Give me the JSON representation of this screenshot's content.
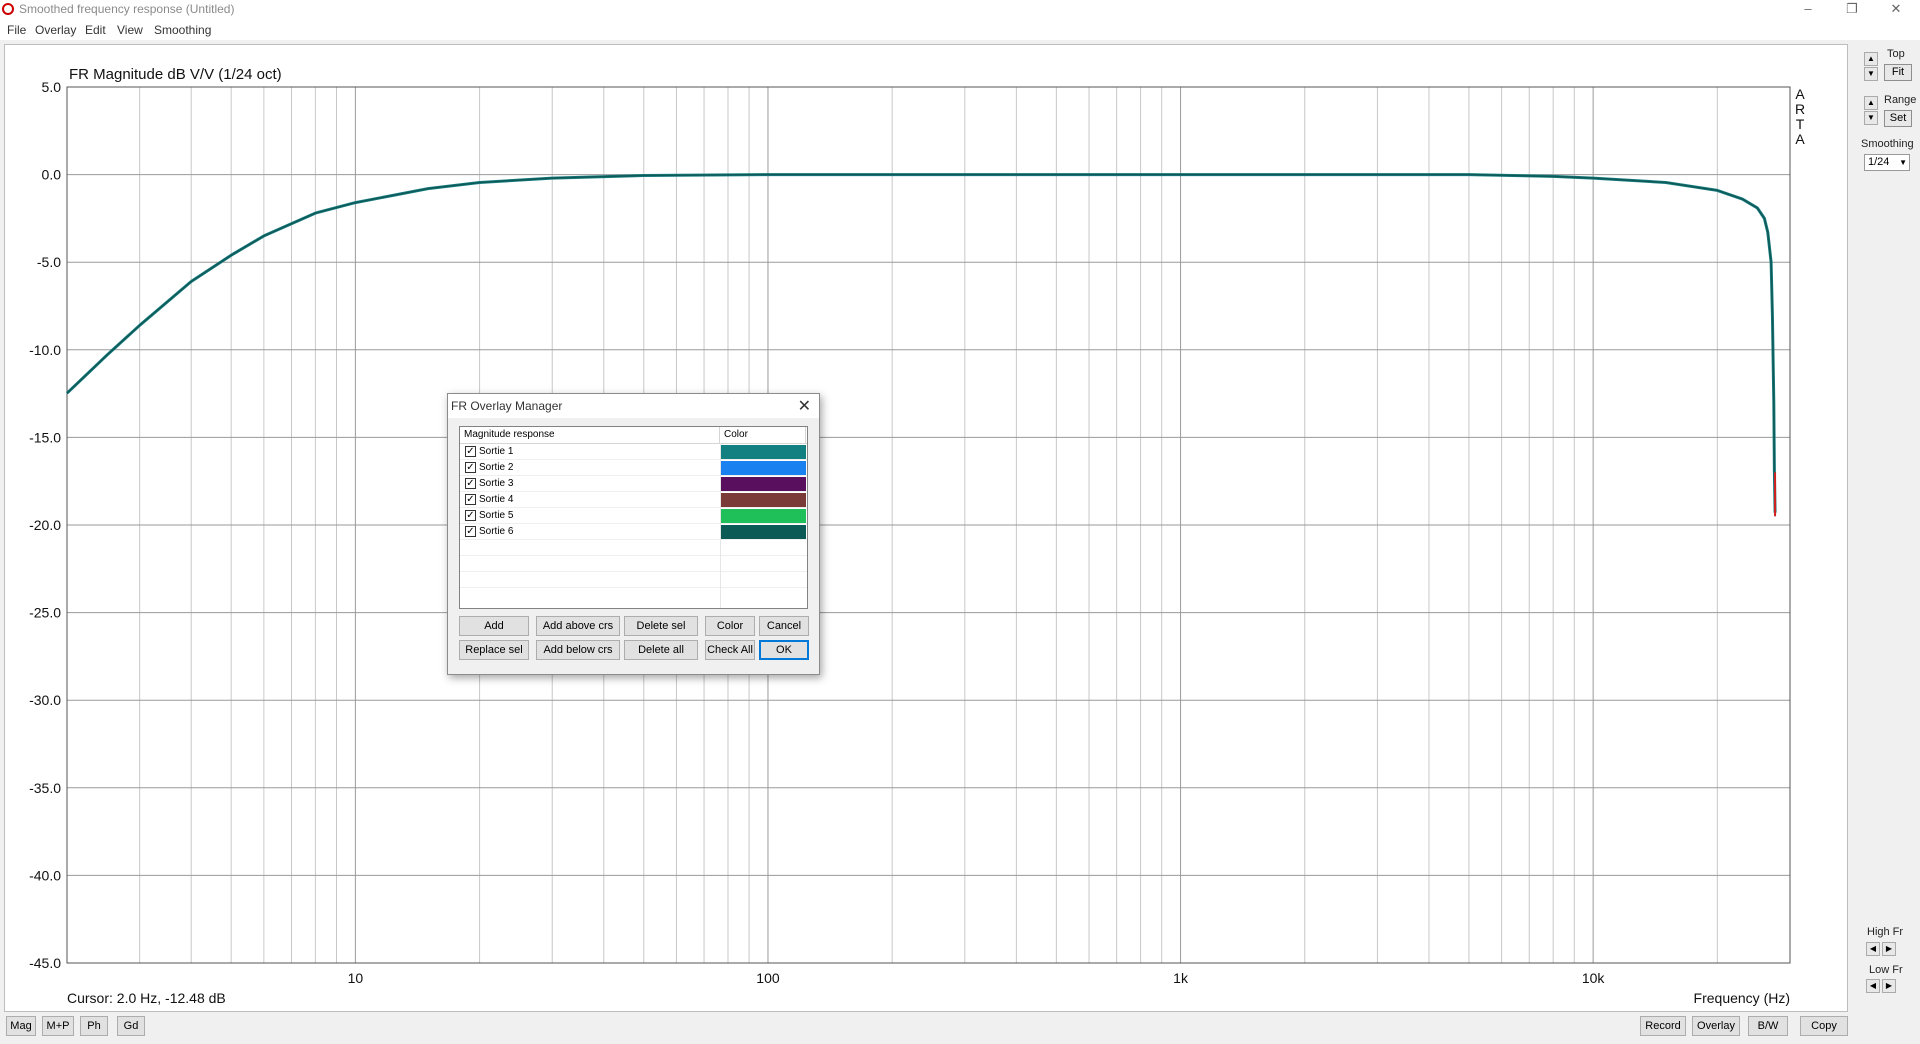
{
  "window": {
    "title": "Smoothed frequency response (Untitled)",
    "minimize": "–",
    "restore": "❐",
    "close": "✕"
  },
  "menu": [
    "File",
    "Overlay",
    "Edit",
    "View",
    "Smoothing"
  ],
  "chart_data": {
    "type": "line",
    "title": "FR Magnitude dB V/V (1/24 oct)",
    "xlabel": "Frequency (Hz)",
    "ylabel": "",
    "x_scale": "log",
    "xlim": [
      2,
      30000
    ],
    "ylim": [
      -45,
      5
    ],
    "y_ticks": [
      "5.0",
      "0.0",
      "-5.0",
      "-10.0",
      "-15.0",
      "-20.0",
      "-25.0",
      "-30.0",
      "-35.0",
      "-40.0",
      "-45.0"
    ],
    "x_tick_labels": [
      {
        "value": 10,
        "label": "10"
      },
      {
        "value": 100,
        "label": "100"
      },
      {
        "value": 1000,
        "label": "1k"
      },
      {
        "value": 10000,
        "label": "10k"
      }
    ],
    "grid": true,
    "side_text": "ARTA",
    "cursor_readout": "Cursor: 2.0 Hz, -12.48 dB",
    "series": [
      {
        "name": "Sortie 1",
        "color": "#1a7f83",
        "x": [
          2,
          2.5,
          3,
          4,
          5,
          6,
          8,
          10,
          15,
          20,
          30,
          50,
          100,
          1000,
          5000,
          8000,
          10000,
          15000,
          20000,
          23000,
          25000,
          26000,
          26500,
          27000,
          27200,
          27400,
          27500,
          27600
        ],
        "y": [
          -12.48,
          -10.3,
          -8.6,
          -6.1,
          -4.6,
          -3.5,
          -2.2,
          -1.6,
          -0.8,
          -0.45,
          -0.2,
          -0.05,
          0,
          0,
          0,
          -0.1,
          -0.2,
          -0.45,
          -0.9,
          -1.4,
          -1.9,
          -2.5,
          -3.3,
          -5,
          -8,
          -13,
          -17,
          -19.3
        ]
      },
      {
        "name": "Sortie 6",
        "color": "#0e5a58",
        "x": [
          2,
          2.5,
          3,
          4,
          5,
          6,
          8,
          10,
          15,
          20,
          30,
          50,
          100,
          1000,
          5000,
          8000,
          10000,
          15000,
          20000,
          23000,
          25000,
          26000,
          26500,
          27000,
          27200,
          27400,
          27500,
          27600
        ],
        "y": [
          -12.48,
          -10.3,
          -8.6,
          -6.1,
          -4.6,
          -3.5,
          -2.2,
          -1.6,
          -0.8,
          -0.45,
          -0.2,
          -0.05,
          0,
          0,
          0,
          -0.1,
          -0.2,
          -0.45,
          -0.9,
          -1.4,
          -1.9,
          -2.5,
          -3.3,
          -5,
          -8,
          -13,
          -17,
          -19.5
        ]
      }
    ]
  },
  "right_panel": {
    "top_label": "Top",
    "fit_button": "Fit",
    "range_label": "Range",
    "set_button": "Set",
    "smoothing_label": "Smoothing",
    "smoothing_value": "1/24",
    "high_fr_label": "High Fr",
    "low_fr_label": "Low Fr",
    "up_arrow": "▲",
    "down_arrow": "▼",
    "left_arrow": "◀",
    "right_arrow": "▶",
    "combo_arrow": "▼"
  },
  "bottom_left": [
    "Mag",
    "M+P",
    "Ph",
    "Gd"
  ],
  "bottom_right": [
    "Record",
    "Overlay",
    "B/W",
    "Copy"
  ],
  "dialog": {
    "title": "FR Overlay Manager",
    "close": "✕",
    "col_name": "Magnitude response",
    "col_color": "Color",
    "check_mark": "✓",
    "rows": [
      {
        "label": "Sortie 1",
        "checked": true,
        "color": "#128080"
      },
      {
        "label": "Sortie 2",
        "checked": true,
        "color": "#1a82f0"
      },
      {
        "label": "Sortie 3",
        "checked": true,
        "color": "#5a0f5e"
      },
      {
        "label": "Sortie 4",
        "checked": true,
        "color": "#7a3b38"
      },
      {
        "label": "Sortie 5",
        "checked": true,
        "color": "#1fbf5a"
      },
      {
        "label": "Sortie 6",
        "checked": true,
        "color": "#0b5a56"
      }
    ],
    "buttons_row1": [
      "Add",
      "Add above crs",
      "Delete sel",
      "Color",
      "Cancel"
    ],
    "buttons_row2": [
      "Replace sel",
      "Add below crs",
      "Delete all",
      "Check All",
      "OK"
    ]
  }
}
